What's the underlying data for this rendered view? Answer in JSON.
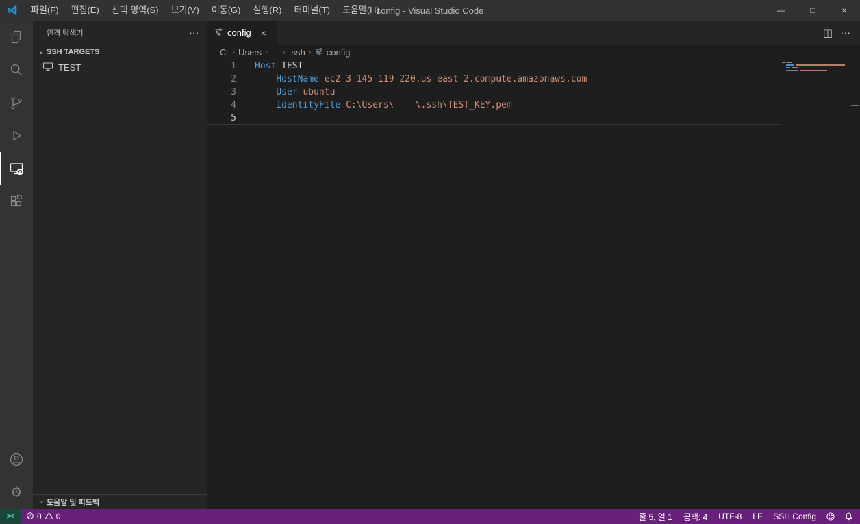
{
  "colors": {
    "status_bar": "#68217a",
    "title_bar": "#323233",
    "activity_bar": "#333333",
    "sidebar": "#252526",
    "editor": "#1e1e1e",
    "keyword": "#569cd6",
    "string": "#ce9178",
    "remote_bg": "#1a473c",
    "remote_fg": "#48d7a6"
  },
  "icons": {
    "more": "⋯",
    "chevron_down": "∨",
    "chevron_right": ">",
    "close": "×",
    "split_editor": "◫",
    "breadcrumb_separator": "›"
  },
  "title_bar": {
    "title": "config - Visual Studio Code",
    "menus": [
      "파일(F)",
      "편집(E)",
      "선택 영역(S)",
      "보기(V)",
      "이동(G)",
      "실행(R)",
      "터미널(T)",
      "도움말(H)"
    ],
    "controls": {
      "minimize": "—",
      "maximize": "□",
      "close": "×"
    }
  },
  "activity_bar": {
    "items": [
      "explorer",
      "search",
      "source-control",
      "run-and-debug",
      "remote-explorer",
      "extensions"
    ],
    "active": "remote-explorer",
    "bottom": [
      "accounts",
      "settings"
    ]
  },
  "sidebar": {
    "title": "원격 탐색기",
    "sections": [
      {
        "label": "SSH TARGETS",
        "expanded": true,
        "items": [
          {
            "label": "TEST",
            "icon": "vm-icon"
          }
        ]
      }
    ],
    "footer": {
      "label": "도움말 및 피드백"
    }
  },
  "editor": {
    "tabs": [
      {
        "label": "config",
        "active": true
      }
    ],
    "breadcrumbs": [
      "C:",
      "Users",
      "",
      ".ssh",
      "config"
    ],
    "code": {
      "lines": [
        {
          "number": "1",
          "current": false,
          "tokens": [
            {
              "type": "keyword",
              "text": "Host"
            },
            {
              "type": "plain",
              "text": " TEST"
            }
          ]
        },
        {
          "number": "2",
          "current": false,
          "tokens": [
            {
              "type": "plain",
              "text": "    "
            },
            {
              "type": "keyword",
              "text": "HostName"
            },
            {
              "type": "plain",
              "text": " "
            },
            {
              "type": "string",
              "text": "ec2-3-145-119-220.us-east-2.compute.amazonaws.com"
            }
          ]
        },
        {
          "number": "3",
          "current": false,
          "tokens": [
            {
              "type": "plain",
              "text": "    "
            },
            {
              "type": "keyword",
              "text": "User"
            },
            {
              "type": "plain",
              "text": " "
            },
            {
              "type": "string",
              "text": "ubuntu"
            }
          ]
        },
        {
          "number": "4",
          "current": false,
          "tokens": [
            {
              "type": "plain",
              "text": "    "
            },
            {
              "type": "keyword",
              "text": "IdentityFile"
            },
            {
              "type": "plain",
              "text": " "
            },
            {
              "type": "string",
              "text": "C:\\Users\\    \\.ssh\\TEST_KEY.pem"
            }
          ]
        },
        {
          "number": "5",
          "current": true,
          "tokens": []
        }
      ]
    },
    "minimap": {
      "lines": [
        {
          "indent": 0,
          "segments": [
            {
              "c": "#569cd6",
              "w": 6
            },
            {
              "c": "#9aa0a6",
              "w": 7
            }
          ]
        },
        {
          "indent": 6,
          "segments": [
            {
              "c": "#569cd6",
              "w": 12
            },
            {
              "c": "#ce9178",
              "w": 72
            }
          ]
        },
        {
          "indent": 6,
          "segments": [
            {
              "c": "#569cd6",
              "w": 6
            },
            {
              "c": "#ce9178",
              "w": 10
            }
          ]
        },
        {
          "indent": 6,
          "segments": [
            {
              "c": "#569cd6",
              "w": 18
            },
            {
              "c": "#ce9178",
              "w": 40
            }
          ]
        }
      ]
    }
  },
  "status_bar": {
    "remote_label": "><",
    "problems": {
      "errors": "0",
      "warnings": "0"
    },
    "right": [
      {
        "name": "cursor-position",
        "label": "줄 5, 열 1"
      },
      {
        "name": "indentation",
        "label": "공백: 4"
      },
      {
        "name": "encoding",
        "label": "UTF-8"
      },
      {
        "name": "eol",
        "label": "LF"
      },
      {
        "name": "language-mode",
        "label": "SSH Config"
      }
    ]
  }
}
